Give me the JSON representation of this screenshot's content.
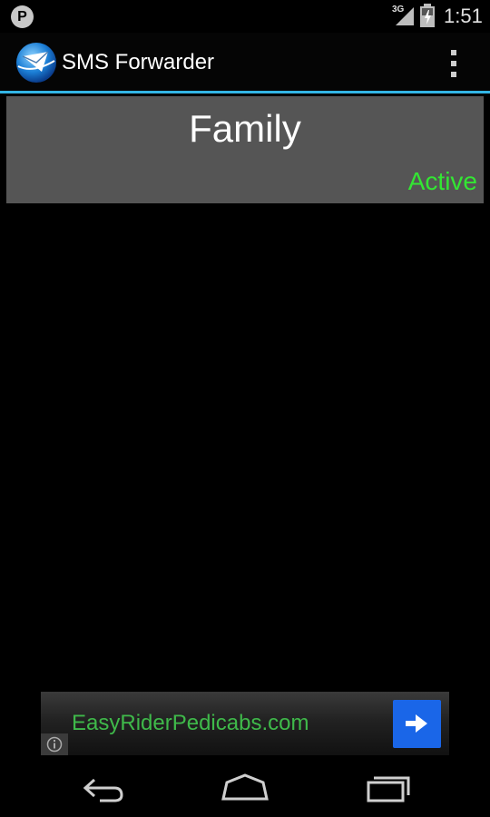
{
  "status_bar": {
    "time": "1:51",
    "network_type": "3G",
    "notification_badge": "P",
    "icons": [
      "p-notification-icon",
      "signal-icon",
      "battery-icon"
    ]
  },
  "action_bar": {
    "title": "SMS Forwarder",
    "icons": [
      "app-icon",
      "overflow-menu-icon"
    ]
  },
  "rules": [
    {
      "name": "Family",
      "status": "Active"
    }
  ],
  "ad": {
    "text": "EasyRiderPedicabs.com",
    "icons": [
      "arrow-right-icon",
      "info-icon"
    ]
  },
  "nav_bar": {
    "icons": [
      "back-icon",
      "home-icon",
      "recent-apps-icon"
    ]
  },
  "colors": {
    "accent": "#33b5e5",
    "card_bg": "#555555",
    "active_status": "#33e633",
    "ad_text": "#3fb94a",
    "ad_button": "#1a66e8"
  }
}
